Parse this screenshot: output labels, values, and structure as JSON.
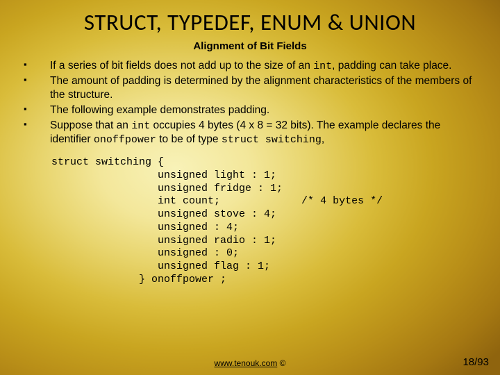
{
  "title": "STRUCT, TYPEDEF, ENUM & UNION",
  "subtitle": "Alignment of Bit Fields",
  "bullets": [
    {
      "pre": "If a series of bit fields does not add up to the size of an ",
      "code": "int",
      "post": ", padding can take place."
    },
    {
      "pre": "The amount of padding is determined by the alignment characteristics of the members of the structure.",
      "code": "",
      "post": ""
    },
    {
      "pre": "The following example demonstrates padding.",
      "code": "",
      "post": ""
    },
    {
      "pre": "Suppose that an ",
      "code": "int",
      "post": " occupies 4 bytes (4 x 8 = 32 bits). The example declares the identifier ",
      "code2": "onoffpower",
      "post2": " to be of type ",
      "code3": "struct switching",
      "post3": ","
    }
  ],
  "code": "struct switching {\n                 unsigned light : 1;\n                 unsigned fridge : 1;\n                 int count;             /* 4 bytes */\n                 unsigned stove : 4;\n                 unsigned : 4;\n                 unsigned radio : 1;\n                 unsigned : 0;\n                 unsigned flag : 1;\n              } onoffpower ;",
  "footer": {
    "link_text": "www.tenouk.com",
    "copyright": " ©"
  },
  "pagenum": "18/93"
}
